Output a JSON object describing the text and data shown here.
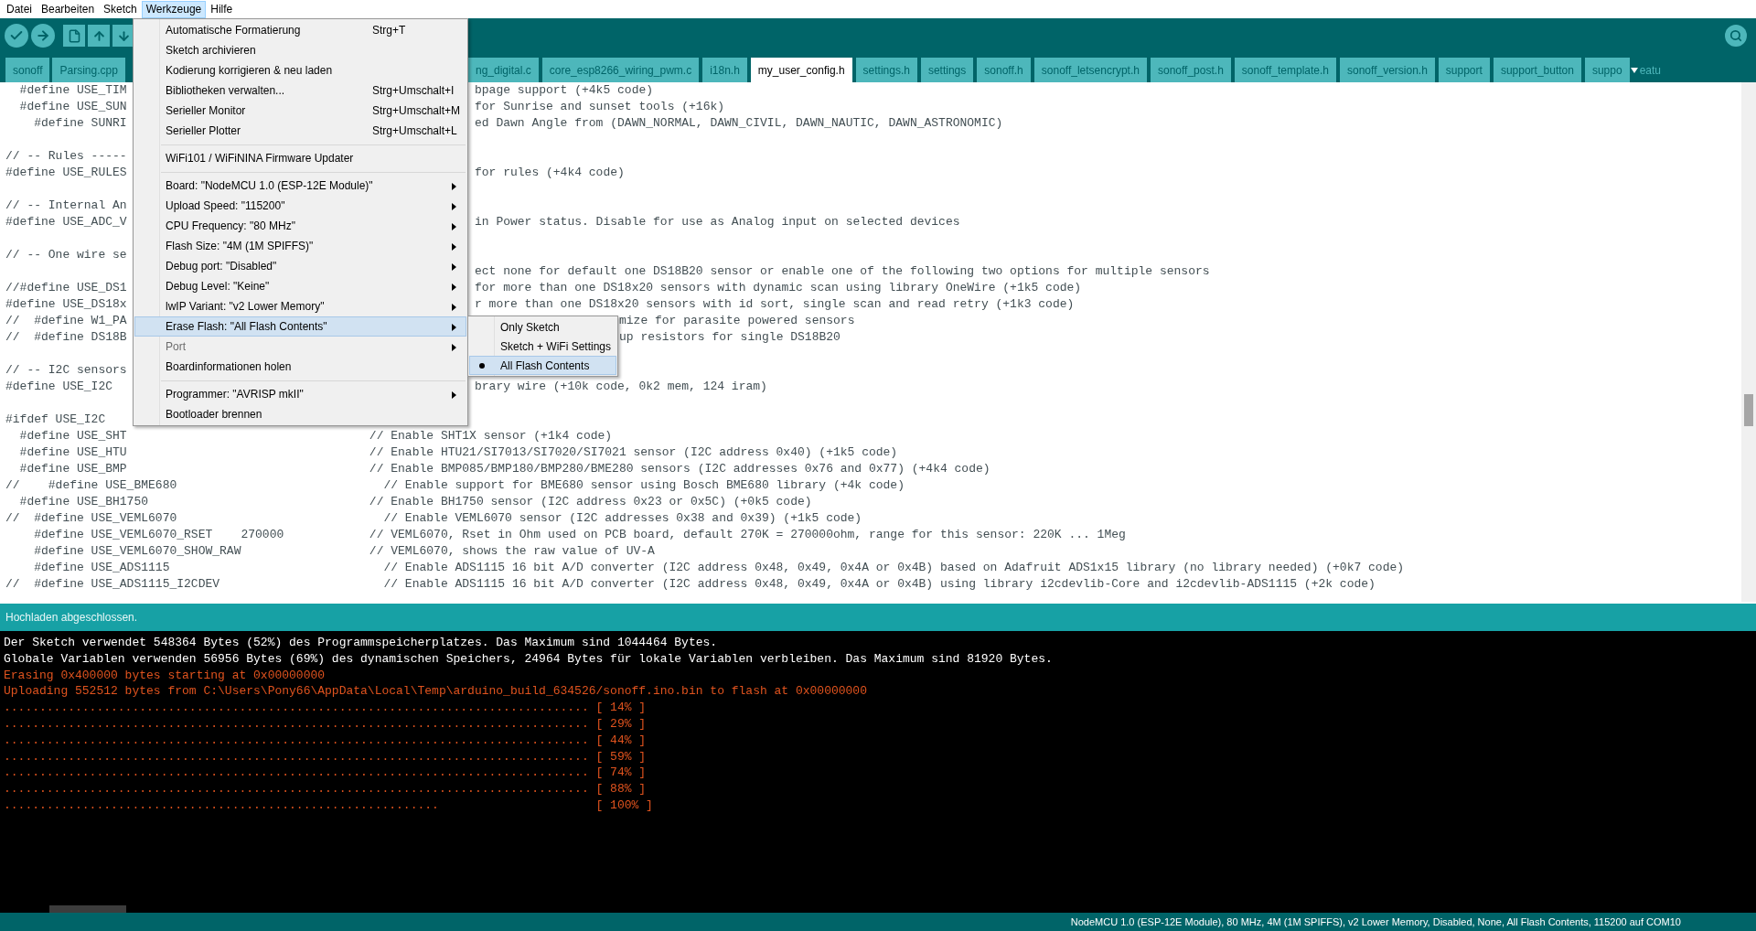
{
  "menubar": [
    {
      "label": "Datei",
      "selected": false
    },
    {
      "label": "Bearbeiten",
      "selected": false
    },
    {
      "label": "Sketch",
      "selected": false
    },
    {
      "label": "Werkzeuge",
      "selected": true
    },
    {
      "label": "Hilfe",
      "selected": false
    }
  ],
  "tab_groups": [
    [
      {
        "label": "sonoff",
        "selected": false
      },
      {
        "label": "Parsing.cpp",
        "selected": false
      }
    ],
    [
      {
        "label": "ng_digital.c",
        "selected": false
      },
      {
        "label": "core_esp8266_wiring_pwm.c",
        "selected": false
      },
      {
        "label": "i18n.h",
        "selected": false
      },
      {
        "label": "my_user_config.h",
        "selected": true
      },
      {
        "label": "settings.h",
        "selected": false
      },
      {
        "label": "settings",
        "selected": false
      },
      {
        "label": "sonoff.h",
        "selected": false
      },
      {
        "label": "sonoff_letsencrypt.h",
        "selected": false
      },
      {
        "label": "sonoff_post.h",
        "selected": false
      },
      {
        "label": "sonoff_template.h",
        "selected": false
      },
      {
        "label": "sonoff_version.h",
        "selected": false
      },
      {
        "label": "support",
        "selected": false
      },
      {
        "label": "support_button",
        "selected": false
      },
      {
        "label": "suppo",
        "selected": false
      }
    ]
  ],
  "tab_overflow_text": "eatu",
  "code_lines": [
    {
      "kind": "behind_menu",
      "text": "  #define USE_TIM",
      "tail": "bpage support (+4k5 code)"
    },
    {
      "kind": "behind_menu",
      "text": "  #define USE_SUN",
      "tail": "for Sunrise and sunset tools (+16k)"
    },
    {
      "kind": "behind_menu",
      "text": "    #define SUNRI",
      "tail": "ed Dawn Angle from (DAWN_NORMAL, DAWN_CIVIL, DAWN_NAUTIC, DAWN_ASTRONOMIC)"
    },
    {
      "kind": "blank"
    },
    {
      "kind": "code",
      "text": "// -- Rules -----"
    },
    {
      "kind": "behind_menu",
      "text": "#define USE_RULES",
      "tail": "for rules (+4k4 code)"
    },
    {
      "kind": "blank"
    },
    {
      "kind": "code",
      "text": "// -- Internal An"
    },
    {
      "kind": "behind_menu",
      "text": "#define USE_ADC_V",
      "tail": "in Power status. Disable for use as Analog input on selected devices"
    },
    {
      "kind": "blank"
    },
    {
      "kind": "code",
      "text": "// -- One wire se"
    },
    {
      "kind": "behind_menu",
      "tail": "ect none for default one DS18B20 sensor or enable one of the following two options for multiple sensors"
    },
    {
      "kind": "behind_menu",
      "text": "//#define USE_DS1",
      "tail": "for more than one DS18x20 sensors with dynamic scan using library OneWire (+1k5 code)"
    },
    {
      "kind": "behind_menu",
      "text": "#define USE_DS18x",
      "tail": "r more than one DS18x20 sensors with id sort, single scan and read retry (+1k3 code)"
    },
    {
      "kind": "behind_submenu",
      "text": "//  #define W1_PA",
      "tail": "mize for parasite powered sensors"
    },
    {
      "kind": "behind_submenu",
      "text": "//  #define DS18B",
      "tail": "up resistors for single DS18B20"
    },
    {
      "kind": "blank"
    },
    {
      "kind": "code",
      "text": "// -- I2C sensors"
    },
    {
      "kind": "behind_menu",
      "text": "#define USE_I2C",
      "tail": "brary wire (+10k code, 0k2 mem, 124 iram)"
    },
    {
      "kind": "blank"
    },
    {
      "kind": "code",
      "text": "#ifdef USE_I2C"
    },
    {
      "kind": "code",
      "text": "  #define USE_SHT                                  // Enable SHT1X sensor (+1k4 code)"
    },
    {
      "kind": "code",
      "text": "  #define USE_HTU                                  // Enable HTU21/SI7013/SI7020/SI7021 sensor (I2C address 0x40) (+1k5 code)"
    },
    {
      "kind": "code",
      "text": "  #define USE_BMP                                  // Enable BMP085/BMP180/BMP280/BME280 sensors (I2C addresses 0x76 and 0x77) (+4k4 code)"
    },
    {
      "kind": "code",
      "text": "//    #define USE_BME680                             // Enable support for BME680 sensor using Bosch BME680 library (+4k code)"
    },
    {
      "kind": "code",
      "text": "  #define USE_BH1750                               // Enable BH1750 sensor (I2C address 0x23 or 0x5C) (+0k5 code)"
    },
    {
      "kind": "code",
      "text": "//  #define USE_VEML6070                             // Enable VEML6070 sensor (I2C addresses 0x38 and 0x39) (+1k5 code)"
    },
    {
      "kind": "code",
      "text": "    #define USE_VEML6070_RSET    270000            // VEML6070, Rset in Ohm used on PCB board, default 270K = 270000ohm, range for this sensor: 220K ... 1Meg"
    },
    {
      "kind": "code",
      "text": "    #define USE_VEML6070_SHOW_RAW                  // VEML6070, shows the raw value of UV-A"
    },
    {
      "kind": "code",
      "text": "    #define USE_ADS1115                              // Enable ADS1115 16 bit A/D converter (I2C address 0x48, 0x49, 0x4A or 0x4B) based on Adafruit ADS1x15 library (no library needed) (+0k7 code)"
    },
    {
      "kind": "code",
      "text": "//  #define USE_ADS1115_I2CDEV                       // Enable ADS1115 16 bit A/D converter (I2C address 0x48, 0x49, 0x4A or 0x4B) using library i2cdevlib-Core and i2cdevlib-ADS1115 (+2k code)"
    }
  ],
  "tools_menu": [
    {
      "kind": "item",
      "label": "Automatische Formatierung",
      "shortcut": "Strg+T",
      "has_submenu": false,
      "highlighted": false,
      "disabled": false
    },
    {
      "kind": "item",
      "label": "Sketch archivieren",
      "has_submenu": false,
      "highlighted": false,
      "disabled": false
    },
    {
      "kind": "item",
      "label": "Kodierung korrigieren & neu laden",
      "has_submenu": false,
      "highlighted": false,
      "disabled": false
    },
    {
      "kind": "item",
      "label": "Bibliotheken verwalten...",
      "shortcut": "Strg+Umschalt+I",
      "has_submenu": false,
      "highlighted": false,
      "disabled": false
    },
    {
      "kind": "item",
      "label": "Serieller Monitor",
      "shortcut": "Strg+Umschalt+M",
      "has_submenu": false,
      "highlighted": false,
      "disabled": false
    },
    {
      "kind": "item",
      "label": "Serieller Plotter",
      "shortcut": "Strg+Umschalt+L",
      "has_submenu": false,
      "highlighted": false,
      "disabled": false
    },
    {
      "kind": "separator"
    },
    {
      "kind": "item",
      "label": "WiFi101 / WiFiNINA Firmware Updater",
      "has_submenu": false,
      "highlighted": false,
      "disabled": false
    },
    {
      "kind": "separator"
    },
    {
      "kind": "item",
      "label": "Board: \"NodeMCU 1.0 (ESP-12E Module)\"",
      "has_submenu": true,
      "highlighted": false,
      "disabled": false
    },
    {
      "kind": "item",
      "label": "Upload Speed: \"115200\"",
      "has_submenu": true,
      "highlighted": false,
      "disabled": false
    },
    {
      "kind": "item",
      "label": "CPU Frequency: \"80 MHz\"",
      "has_submenu": true,
      "highlighted": false,
      "disabled": false
    },
    {
      "kind": "item",
      "label": "Flash Size: \"4M (1M SPIFFS)\"",
      "has_submenu": true,
      "highlighted": false,
      "disabled": false
    },
    {
      "kind": "item",
      "label": "Debug port: \"Disabled\"",
      "has_submenu": true,
      "highlighted": false,
      "disabled": false
    },
    {
      "kind": "item",
      "label": "Debug Level: \"Keine\"",
      "has_submenu": true,
      "highlighted": false,
      "disabled": false
    },
    {
      "kind": "item",
      "label": "lwIP Variant: \"v2 Lower Memory\"",
      "has_submenu": true,
      "highlighted": false,
      "disabled": false
    },
    {
      "kind": "item",
      "label": "Erase Flash: \"All Flash Contents\"",
      "has_submenu": true,
      "highlighted": true,
      "disabled": false
    },
    {
      "kind": "item",
      "label": "Port",
      "has_submenu": true,
      "highlighted": false,
      "disabled": true
    },
    {
      "kind": "item",
      "label": "Boardinformationen holen",
      "has_submenu": false,
      "highlighted": false,
      "disabled": false
    },
    {
      "kind": "separator"
    },
    {
      "kind": "item",
      "label": "Programmer: \"AVRISP mkII\"",
      "has_submenu": true,
      "highlighted": false,
      "disabled": false
    },
    {
      "kind": "item",
      "label": "Bootloader brennen",
      "has_submenu": false,
      "highlighted": false,
      "disabled": false
    }
  ],
  "erase_submenu": [
    {
      "label": "Only Sketch",
      "selected": false
    },
    {
      "label": "Sketch + WiFi Settings",
      "selected": false
    },
    {
      "label": "All Flash Contents",
      "selected": true
    }
  ],
  "message_bar": "Hochladen abgeschlossen.",
  "console": [
    {
      "kind": "info",
      "text": "Der Sketch verwendet 548364 Bytes (52%) des Programmspeicherplatzes. Das Maximum sind 1044464 Bytes."
    },
    {
      "kind": "info",
      "text": "Globale Variablen verwenden 56956 Bytes (69%) des dynamischen Speichers, 24964 Bytes für lokale Variablen verbleiben. Das Maximum sind 81920 Bytes."
    },
    {
      "kind": "error",
      "text": "Erasing 0x400000 bytes starting at 0x00000000"
    },
    {
      "kind": "error",
      "text": "Uploading 552512 bytes from C:\\Users\\Pony66\\AppData\\Local\\Temp\\arduino_build_634526/sonoff.ino.bin to flash at 0x00000000"
    },
    {
      "kind": "error",
      "text": ".................................................................................. [ 14% ]"
    },
    {
      "kind": "error",
      "text": ".................................................................................. [ 29% ]"
    },
    {
      "kind": "error",
      "text": ".................................................................................. [ 44% ]"
    },
    {
      "kind": "error",
      "text": ".................................................................................. [ 59% ]"
    },
    {
      "kind": "error",
      "text": ".................................................................................. [ 74% ]"
    },
    {
      "kind": "error",
      "text": ".................................................................................. [ 88% ]"
    },
    {
      "kind": "error",
      "text": ".............................................................                      [ 100% ]"
    }
  ],
  "status_bar": "NodeMCU 1.0 (ESP-12E Module), 80 MHz, 4M (1M SPIFFS), v2 Lower Memory, Disabled, None, All Flash Contents, 115200 auf COM10"
}
